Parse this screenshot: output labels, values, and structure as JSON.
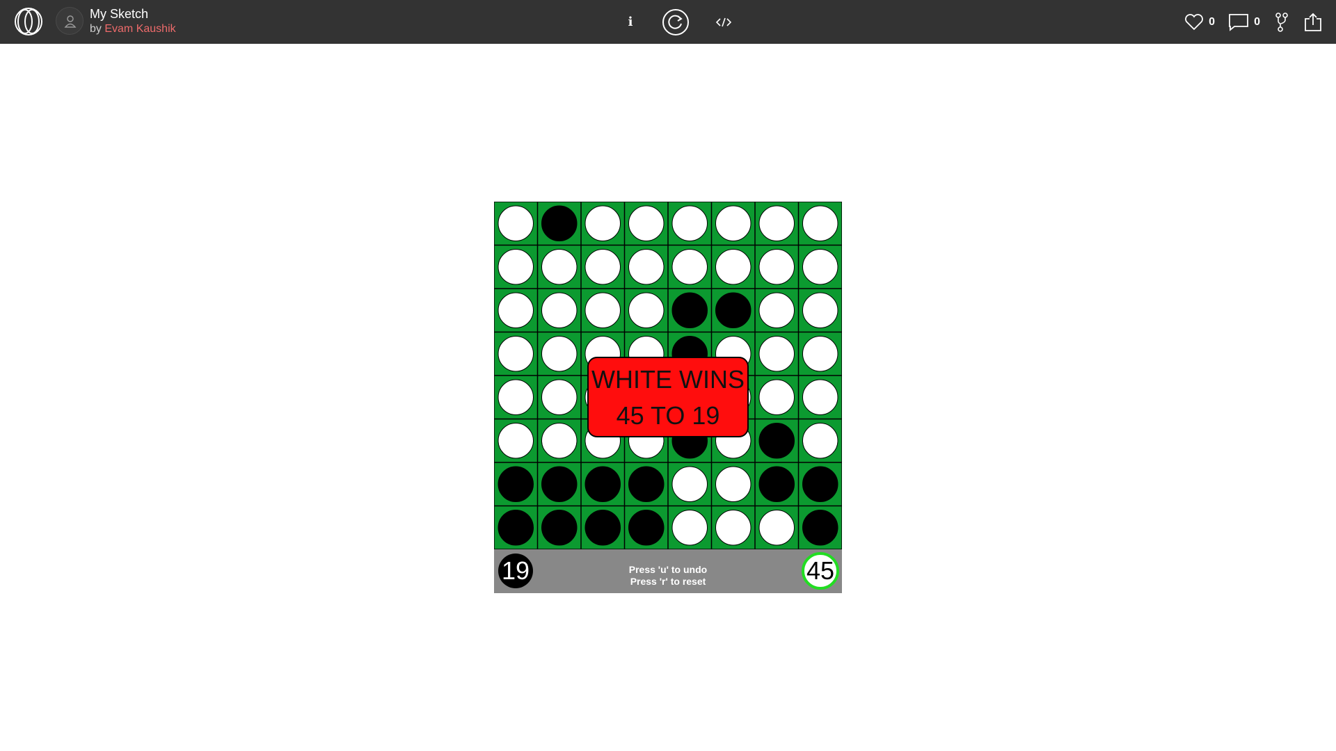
{
  "header": {
    "sketch_title": "My Sketch",
    "by_prefix": "by",
    "author": "Evam Kaushik",
    "info_label": "i",
    "likes": "0",
    "comments": "0"
  },
  "icons": {
    "logo": "openprocessing-logo-icon",
    "avatar": "user-icon",
    "restart": "restart-icon",
    "code": "code-icon",
    "like": "heart-icon",
    "comment": "comment-icon",
    "fork": "fork-icon",
    "share": "share-icon"
  },
  "colors": {
    "topbar": "#333333",
    "author": "#ee6b6b",
    "board": "#0c9a30",
    "status_bar": "#888888",
    "win_box": "#ff0d0d",
    "white_score_ring": "#22dd22"
  },
  "game": {
    "board": [
      [
        "W",
        "B",
        "W",
        "W",
        "W",
        "W",
        "W",
        "W"
      ],
      [
        "W",
        "W",
        "W",
        "W",
        "W",
        "W",
        "W",
        "W"
      ],
      [
        "W",
        "W",
        "W",
        "W",
        "B",
        "B",
        "W",
        "W"
      ],
      [
        "W",
        "W",
        "W",
        "W",
        "B",
        "W",
        "W",
        "W"
      ],
      [
        "W",
        "W",
        "W",
        "W",
        "W",
        "W",
        "W",
        "W"
      ],
      [
        "W",
        "W",
        "W",
        "W",
        "B",
        "W",
        "B",
        "W"
      ],
      [
        "B",
        "B",
        "B",
        "B",
        "W",
        "W",
        "B",
        "B"
      ],
      [
        "B",
        "B",
        "B",
        "B",
        "W",
        "W",
        "W",
        "B"
      ]
    ],
    "black_score": "19",
    "white_score": "45",
    "hint_undo": "Press 'u' to undo",
    "hint_reset": "Press 'r' to reset",
    "win_line1": "WHITE WINS",
    "win_line2": "45 TO 19"
  }
}
